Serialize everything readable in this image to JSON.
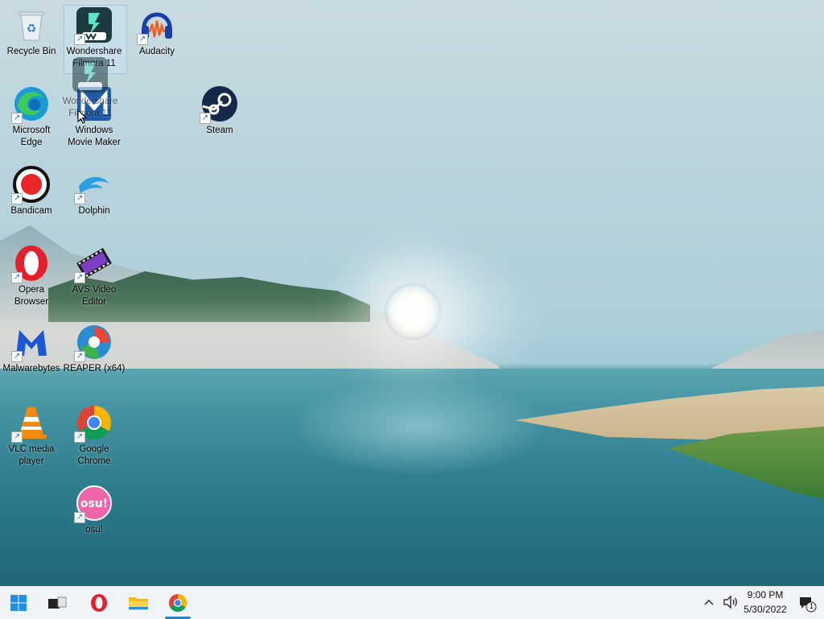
{
  "desktop": {
    "icons": [
      {
        "name": "Recycle Bin",
        "lines": [
          "Recycle Bin"
        ]
      },
      {
        "name": "Wondershare Filmora 11",
        "lines": [
          "Wondershare",
          "Filmora 11"
        ]
      },
      {
        "name": "Audacity",
        "lines": [
          "Audacity"
        ]
      },
      {
        "name": "Microsoft Edge",
        "lines": [
          "Microsoft",
          "Edge"
        ]
      },
      {
        "name": "Windows Movie Maker",
        "lines": [
          "Windows",
          "Movie Maker"
        ]
      },
      {
        "name": "Steam",
        "lines": [
          "Steam"
        ]
      },
      {
        "name": "Bandicam",
        "lines": [
          "Bandicam"
        ]
      },
      {
        "name": "Dolphin",
        "lines": [
          "Dolphin"
        ]
      },
      {
        "name": "Opera Browser",
        "lines": [
          "Opera",
          "Browser"
        ]
      },
      {
        "name": "AVS Video Editor",
        "lines": [
          "AVS Video",
          "Editor"
        ]
      },
      {
        "name": "Malwarebytes",
        "lines": [
          "Malwarebytes"
        ]
      },
      {
        "name": "REAPER (x64)",
        "lines": [
          "REAPER (x64)"
        ]
      },
      {
        "name": "VLC media player",
        "lines": [
          "VLC media",
          "player"
        ]
      },
      {
        "name": "Google Chrome",
        "lines": [
          "Google",
          "Chrome"
        ]
      },
      {
        "name": "osu!",
        "lines": [
          "osu!"
        ]
      }
    ],
    "drag_ghost": {
      "lines": [
        "Wondershare",
        "Filmora 11"
      ]
    }
  },
  "taskbar": {
    "clock": {
      "time": "9:00 PM",
      "date": "5/30/2022"
    },
    "notification_count": "1",
    "accent": "#2b84c9"
  }
}
